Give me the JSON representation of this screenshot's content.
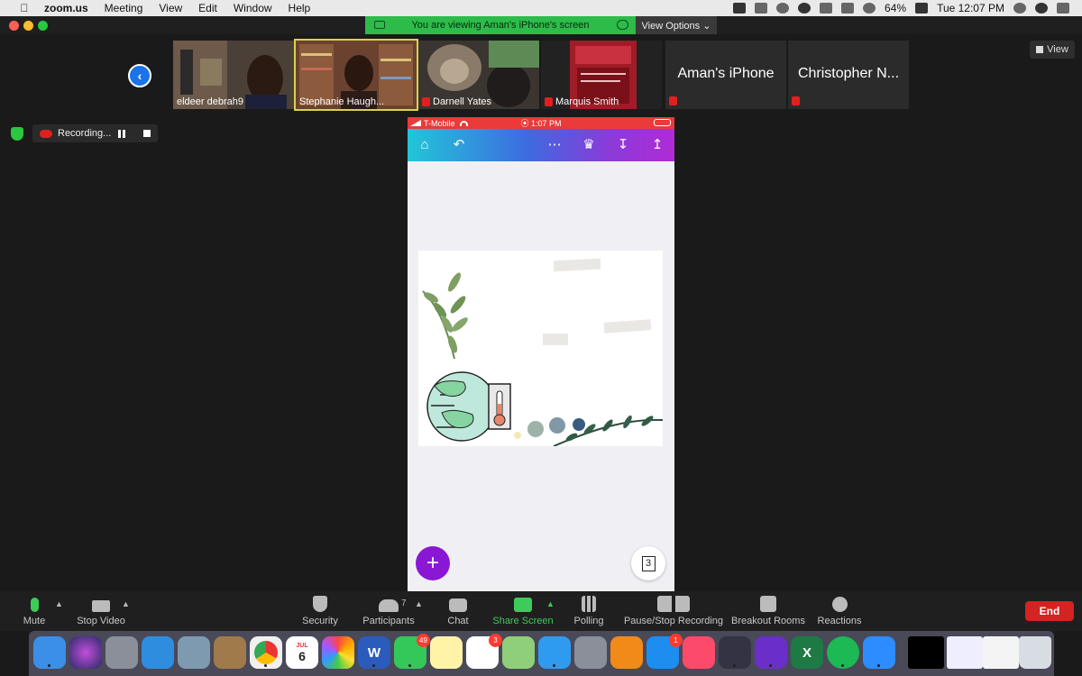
{
  "menubar": {
    "app_name": "zoom.us",
    "menus": [
      "Meeting",
      "View",
      "Edit",
      "Window",
      "Help"
    ],
    "battery": "64%",
    "clock": "Tue 12:07 PM"
  },
  "share_banner": {
    "text": "You are viewing Aman's iPhone's screen",
    "view_options": "View Options ⌄"
  },
  "gallery": {
    "tiles": [
      {
        "name": "eldeer debrah9",
        "muted": false,
        "video": true
      },
      {
        "name": "Stephanie Haugh...",
        "muted": false,
        "video": true,
        "active": true
      },
      {
        "name": "Darnell Yates",
        "muted": true,
        "video": true
      },
      {
        "name": "Marquis Smith",
        "muted": true,
        "video": true
      },
      {
        "name": "Aman's iPhone",
        "muted": true,
        "video": false
      },
      {
        "name": "Christopher N...",
        "muted": true,
        "video": false
      }
    ],
    "view_label": "View"
  },
  "recording": {
    "label": "Recording..."
  },
  "phone": {
    "carrier": "T-Mobile",
    "time": "⦿ 1:07 PM",
    "pages_count": "3"
  },
  "toolbar": {
    "mute": "Mute",
    "stop_video": "Stop Video",
    "security": "Security",
    "participants": "Participants",
    "participants_count": "7",
    "chat": "Chat",
    "share_screen": "Share Screen",
    "polling": "Polling",
    "pause_stop_recording": "Pause/Stop Recording",
    "breakout_rooms": "Breakout Rooms",
    "reactions": "Reactions",
    "end": "End"
  },
  "dock": {
    "calendar_month": "JUL",
    "calendar_day": "6",
    "facetime_badge": "49",
    "reminders_badge": "3",
    "appstore_badge": "1"
  },
  "colors": {
    "accent_blue": "#1a73e8",
    "share_green": "#2dbb4a",
    "end_red": "#d32323",
    "toolbar_gradient_start": "#22c6d8",
    "toolbar_gradient_end": "#b02bd6",
    "fab_purple": "#8a17d4"
  }
}
